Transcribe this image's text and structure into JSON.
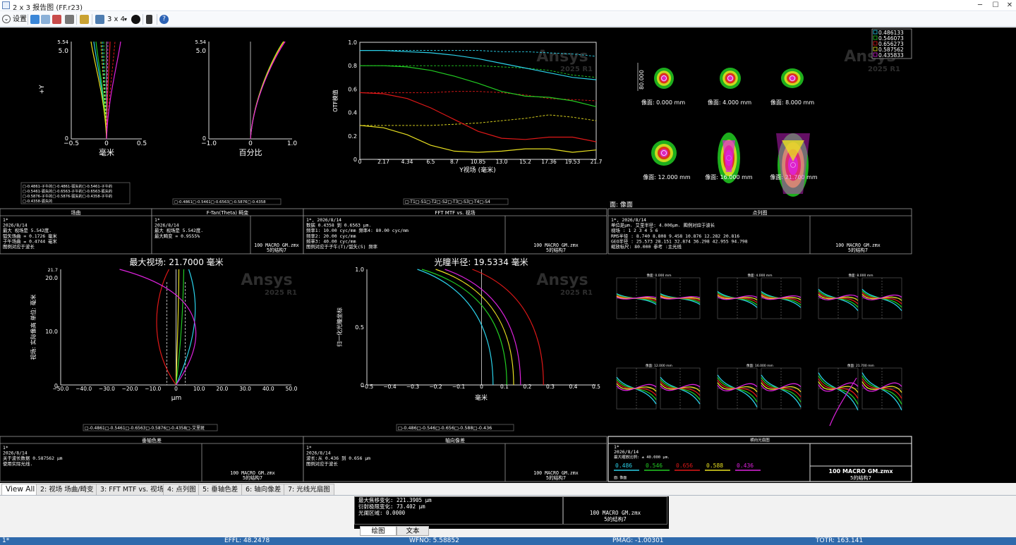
{
  "window": {
    "title": "2 x 3 报告图 (FF.r23)"
  },
  "toolbar": {
    "settings_label": "设置",
    "layout_label": "3 x 4"
  },
  "colors": {
    "blue": "#2ad0e8",
    "green": "#22cc22",
    "red": "#e01818",
    "yellow": "#e8e020",
    "magenta": "#dd22dd"
  },
  "watermark": {
    "brand": "Ansys",
    "version": "2025 R1"
  },
  "panels": {
    "fieldcurve": {
      "ylabel": "+Y",
      "xlabel": "毫米",
      "ytop": "5.54",
      "ymax": "5.0",
      "y0": "0",
      "xticks": [
        "−0.5",
        "0",
        "0.5"
      ],
      "legend": [
        "□-0.4861-子午的□-0.4861-弧矢的□-0.5461-子午的",
        "□-0.5461-弧矢的□-0.6563-子午的□-0.6563-弧矢的",
        "□-0.5876-子午的□-0.5876-弧矢的□-0.4358-子午的",
        "□-0.4358-弧矢的"
      ]
    },
    "distortion": {
      "xlabel": "百分比",
      "ytop": "5.54",
      "ymax": "5.0",
      "y0": "0",
      "xticks": [
        "−1.0",
        "0",
        "1.0"
      ],
      "legend": "□-0.4861□-0.5461□-0.6563□-0.5876□-0.4358"
    },
    "mtf": {
      "ylabel": "OTF模值",
      "xlabel": "Y视场 (毫米)",
      "yticks": [
        "1.0",
        "0.8",
        "0.6",
        "0.4",
        "0.2",
        "0"
      ],
      "xticks": [
        "0",
        "2.17",
        "4.34",
        "6.5",
        "8.7",
        "10.85",
        "13.0",
        "15.2",
        "17.36",
        "19.53",
        "21.7"
      ],
      "legend": "□-T1□-S1□-T2□-S2□-T3□-S3□-T4□-S4"
    },
    "spot": {
      "ylabel": "80.000",
      "face": "面: 像面",
      "labels": [
        "像面: 0.000 mm",
        "像面: 4.000 mm",
        "像面: 8.000 mm",
        "像面: 12.000 mm",
        "像面: 16.000 mm",
        "像面: 21.700 mm"
      ],
      "legend": [
        "0.486133",
        "0.546073",
        "0.656273",
        "0.587562",
        "0.435833"
      ]
    },
    "lateral": {
      "title": "最大视场: 21.7000 毫米",
      "ylabel": "视场: 实际像高 单位: 毫米",
      "xlabel": "μm",
      "ytop": "21.7",
      "yticks": [
        "20.0",
        "10.0",
        "0"
      ],
      "xticks": [
        "−50.0",
        "−40.0",
        "−30.0",
        "−20.0",
        "−10.0",
        "0",
        "10.0",
        "20.0",
        "30.0",
        "40.0",
        "50.0"
      ],
      "legend": "□-0.4861□-0.5461□-0.6563□-0.5876□-0.4358□-艾里斑"
    },
    "axial": {
      "title": "光瞳半径: 19.5334 毫米",
      "ylabel": "归一化光瞳坐标",
      "xlabel": "毫米",
      "yticks": [
        "1.0",
        "0.5",
        "0"
      ],
      "xticks": [
        "−0.5",
        "−0.4",
        "−0.3",
        "−0.2",
        "−0.1",
        "0",
        "0.1",
        "0.2",
        "0.3",
        "0.4",
        "0.5"
      ],
      "legend": "□-0.486□-0.546□-0.656□-0.588□-0.436"
    },
    "fan": {
      "titles": [
        "像面: 0.000 mm",
        "像面: 4.000 mm",
        "像面: 8.000 mm",
        "像面: 12.000 mm",
        "像面: 16.000 mm",
        "像面: 21.700 mm"
      ]
    }
  },
  "boxes": {
    "fc": {
      "title": "场曲",
      "lines": [
        "1*",
        "2026/8/14",
        "最大 视场是 5.542度.",
        "弧矢场曲 = 0.1726 毫米",
        "子午场曲 = 0.4744 毫米",
        "图例对应于波长"
      ]
    },
    "dist": {
      "title": "F-Tan(Theta) 畸变",
      "lines": [
        "1*",
        "2026/8/14",
        "最大 视场是 5.542度.",
        "最大畸变 = 0.9555%"
      ],
      "file1": "100 MACRO GM.zmx",
      "file2": "5的结构7"
    },
    "mtf": {
      "title": "FFT MTF vs. 视场",
      "lines": [
        "1*, 2026/8/14",
        "数据 0.4358 到 0.6563 μm.",
        "频率1:   10.00 cyc/mm       频率4:   80.00 cyc/mm",
        "频率2:   20.00 cyc/mm",
        "频率3:   40.00 cyc/mm",
        "图例对应于子午(T)/弧矢(S) 频率"
      ],
      "file1": "100 MACRO GM.zmx",
      "file2": "5的结构7"
    },
    "spot": {
      "title": "点列图",
      "lines": [
        "1*, 2026/8/14",
        "单位是μm.                 艾里半径: 4.006μm. 图例对应于波长",
        "视场     :      1        2        3        4        5        6",
        "RMS半径  :    8.740    8.808    9.458   10.876   12.282   20.816",
        "GEO半径  :   25.573   28.151   32.874   36.298   42.955   94.798",
        "缩放标尺:   80.000     参考  :主光线"
      ],
      "file1": "100 MACRO GM.zmx",
      "file2": "5的结构7"
    },
    "lat": {
      "title": "垂轴色差",
      "lines": [
        "1*",
        "2026/8/14",
        "关于波长数据 0.587562 μm",
        "使用实际光线."
      ],
      "file1": "100 MACRO GM.zmx",
      "file2": "5的结构7"
    },
    "ax": {
      "title": "轴向像差",
      "lines": [
        "1*",
        "2026/8/14",
        "波长:从 0.436 到 0.656 μm",
        "图例对应于波长"
      ],
      "file1": "100 MACRO GM.zmx",
      "file2": "5的结构7"
    },
    "fan": {
      "title": "横向光扇图",
      "lines": [
        "1*",
        "2026/8/14",
        "最大缩放比例: ± 40.000 μm."
      ],
      "waves": [
        "0.486",
        "0.546",
        "0.656",
        "0.588",
        "0.436"
      ],
      "face": "面: 像面",
      "file1": "100 MACRO GM.zmx",
      "file2": "5的结构7"
    }
  },
  "tabs": [
    "View All",
    "2: 视场 场曲/畸变",
    "3: FFT MTF vs. 视场",
    "4: 点列图",
    "5: 垂轴色差",
    "6: 轴向像差",
    "7: 光线光扇图"
  ],
  "mini": {
    "lines": [
      "最大焦移变化: 221.3905 μm",
      "衍射极限变化: 73.402 μm",
      "光阑区域: 0.0000"
    ],
    "file1": "100 MACRO GM.zmx",
    "file2": "5的结构7"
  },
  "subtabs": [
    "绘图",
    "文本"
  ],
  "status": {
    "config": "1*",
    "effl": "EFFL: 48.2478",
    "wfno": "WFNO: 5.58852",
    "pmag": "PMAG: -1.00301",
    "totr": "TOTR: 163.141"
  }
}
